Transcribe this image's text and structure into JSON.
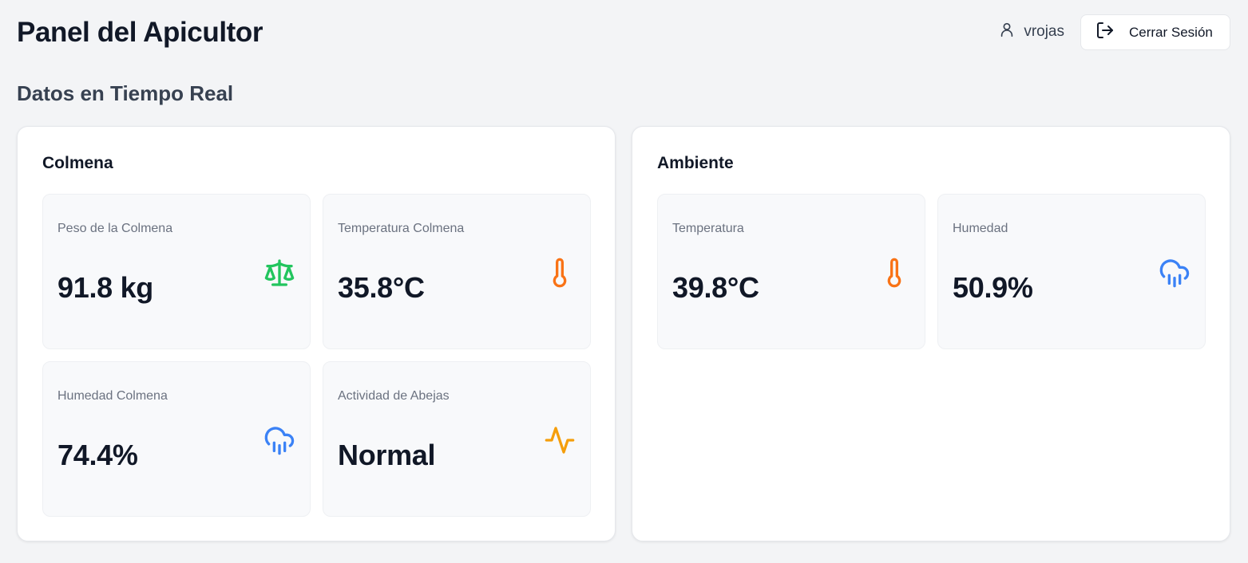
{
  "header": {
    "title": "Panel del Apicultor",
    "username": "vrojas",
    "logout_label": "Cerrar Sesión"
  },
  "section_title": "Datos en Tiempo Real",
  "colmena": {
    "title": "Colmena",
    "metrics": [
      {
        "label": "Peso de la Colmena",
        "value": "91.8 kg",
        "icon": "scale-icon",
        "color": "#22c55e"
      },
      {
        "label": "Temperatura Colmena",
        "value": "35.8°C",
        "icon": "thermometer-icon",
        "color": "#f97316"
      },
      {
        "label": "Humedad Colmena",
        "value": "74.4%",
        "icon": "cloud-rain-icon",
        "color": "#3b82f6"
      },
      {
        "label": "Actividad de Abejas",
        "value": "Normal",
        "icon": "activity-icon",
        "color": "#f59e0b"
      }
    ]
  },
  "ambiente": {
    "title": "Ambiente",
    "metrics": [
      {
        "label": "Temperatura",
        "value": "39.8°C",
        "icon": "thermometer-icon",
        "color": "#f97316"
      },
      {
        "label": "Humedad",
        "value": "50.9%",
        "icon": "cloud-rain-icon",
        "color": "#3b82f6"
      }
    ]
  }
}
